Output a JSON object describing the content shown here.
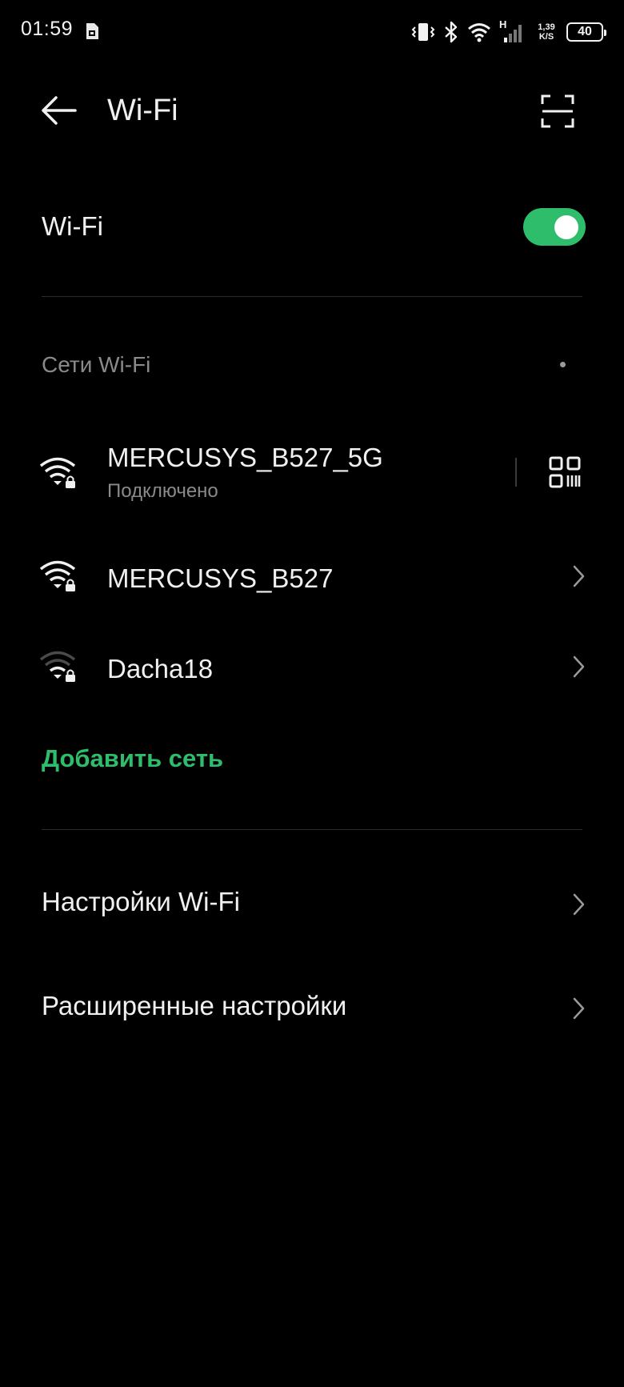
{
  "status_bar": {
    "time": "01:59",
    "network_type": "H",
    "speed_value": "1,39",
    "speed_unit": "K/S",
    "battery_level": "40",
    "icons": [
      "sim-card-icon",
      "vibrate-icon",
      "bluetooth-icon",
      "wifi-status-icon",
      "signal-icon",
      "battery-icon"
    ]
  },
  "header": {
    "title": "Wi-Fi",
    "back_icon": "arrow-left-icon",
    "scan_icon": "scan-frame-icon"
  },
  "wifi_toggle": {
    "label": "Wi-Fi",
    "enabled": true
  },
  "networks_section": {
    "title": "Сети Wi-Fi",
    "networks": [
      {
        "name": "MERCUSYS_B527_5G",
        "status": "Подключено",
        "signal": "full",
        "secured": true,
        "action_icon": "qr-code-icon"
      },
      {
        "name": "MERCUSYS_B527",
        "status": "",
        "signal": "full",
        "secured": true,
        "action_icon": "chevron-right-icon"
      },
      {
        "name": "Dacha18",
        "status": "",
        "signal": "weak",
        "secured": true,
        "action_icon": "chevron-right-icon"
      }
    ]
  },
  "add_network": {
    "label": "Добавить сеть"
  },
  "settings": [
    {
      "label": "Настройки Wi-Fi"
    },
    {
      "label": "Расширенные настройки"
    }
  ],
  "colors": {
    "background": "#000000",
    "accent": "#2ebd6b",
    "text_primary": "#f0f0f0",
    "text_secondary": "#8a8a8a"
  }
}
